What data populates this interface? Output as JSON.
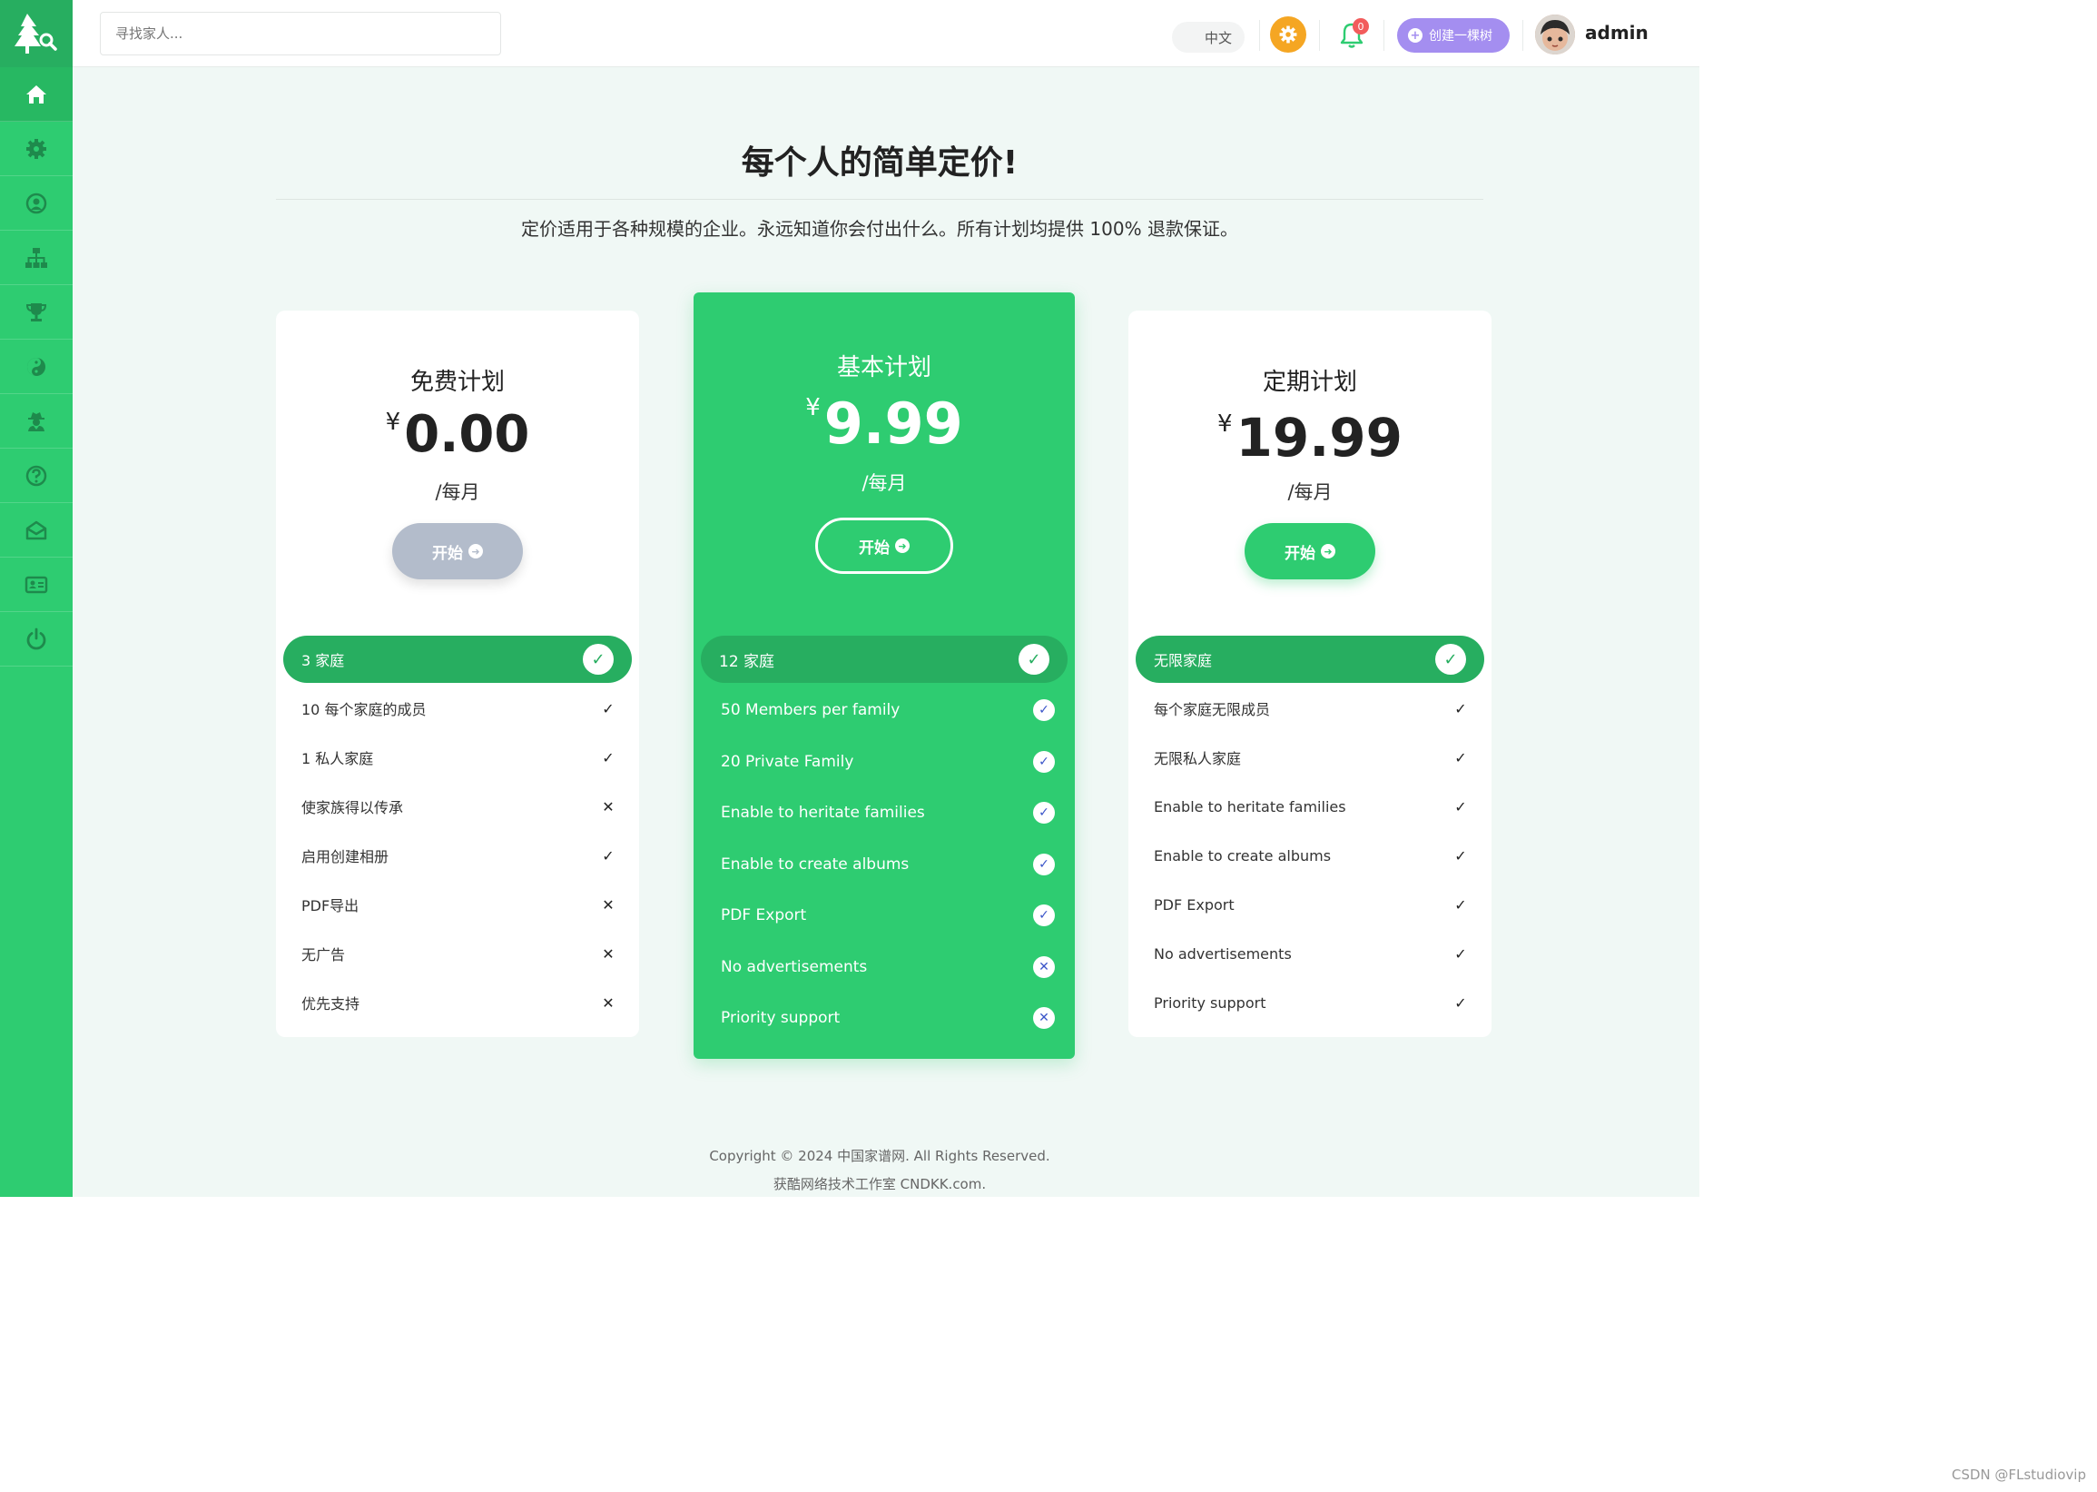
{
  "search": {
    "placeholder": "寻找家人..."
  },
  "header": {
    "lang_label": "中文",
    "notifications_count": "0",
    "create_tree_label": "创建一棵树",
    "username": "admin"
  },
  "sidebar": {
    "items": [
      {
        "icon": "home-icon"
      },
      {
        "icon": "gear-icon"
      },
      {
        "icon": "user-circle-icon"
      },
      {
        "icon": "sitemap-icon"
      },
      {
        "icon": "trophy-icon"
      },
      {
        "icon": "yin-yang-icon"
      },
      {
        "icon": "user-secret-icon"
      },
      {
        "icon": "question-icon"
      },
      {
        "icon": "envelope-open-icon"
      },
      {
        "icon": "id-card-icon"
      },
      {
        "icon": "power-icon"
      }
    ]
  },
  "page": {
    "title": "每个人的简单定价!",
    "subtitle": "定价适用于各种规模的企业。永远知道你会付出什么。所有计划均提供 100% 退款保证。"
  },
  "plans": [
    {
      "name": "免费计划",
      "currency": "¥",
      "price": "0.00",
      "period": "/每月",
      "cta": "开始",
      "features": [
        {
          "label": "3 家庭",
          "included": true
        },
        {
          "label": "10 每个家庭的成员",
          "included": true
        },
        {
          "label": "1 私人家庭",
          "included": true
        },
        {
          "label": "使家族得以传承",
          "included": false
        },
        {
          "label": "启用创建相册",
          "included": true
        },
        {
          "label": "PDF导出",
          "included": false
        },
        {
          "label": "无广告",
          "included": false
        },
        {
          "label": "优先支持",
          "included": false
        }
      ]
    },
    {
      "name": "基本计划",
      "currency": "¥",
      "price": "9.99",
      "period": "/每月",
      "cta": "开始",
      "features": [
        {
          "label": "12 家庭",
          "included": true
        },
        {
          "label": "50 Members per family",
          "included": true
        },
        {
          "label": "20 Private Family",
          "included": true
        },
        {
          "label": "Enable to heritate families",
          "included": true
        },
        {
          "label": "Enable to create albums",
          "included": true
        },
        {
          "label": "PDF Export",
          "included": true
        },
        {
          "label": "No advertisements",
          "included": false
        },
        {
          "label": "Priority support",
          "included": false
        }
      ]
    },
    {
      "name": "定期计划",
      "currency": "¥",
      "price": "19.99",
      "period": "/每月",
      "cta": "开始",
      "features": [
        {
          "label": "无限家庭",
          "included": true
        },
        {
          "label": "每个家庭无限成员",
          "included": true
        },
        {
          "label": "无限私人家庭",
          "included": true
        },
        {
          "label": "Enable to heritate families",
          "included": true
        },
        {
          "label": "Enable to create albums",
          "included": true
        },
        {
          "label": "PDF Export",
          "included": true
        },
        {
          "label": "No advertisements",
          "included": true
        },
        {
          "label": "Priority support",
          "included": true
        }
      ]
    }
  ],
  "footer": {
    "line1": "Copyright © 2024 中国家谱网. All Rights Reserved.",
    "line2": "获酷网络技术工作室 CNDKK.com."
  },
  "watermark": "CSDN @FLstudiovip",
  "colors": {
    "brand_green": "#2ecc71",
    "dark_green": "#27ae60",
    "gear_orange": "#f5a623",
    "create_purple": "#a48ef0",
    "cta_disabled": "#b3bccb"
  }
}
